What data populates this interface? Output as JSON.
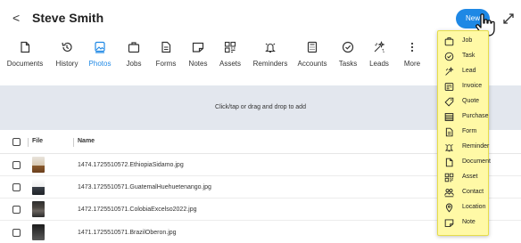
{
  "header": {
    "back_glyph": "<",
    "title": "Steve Smith",
    "new_label": "New"
  },
  "tabs": [
    {
      "label": "Documents",
      "icon": "document-icon"
    },
    {
      "label": "History",
      "icon": "history-icon"
    },
    {
      "label": "Photos",
      "icon": "photo-icon",
      "active": true
    },
    {
      "label": "Jobs",
      "icon": "briefcase-icon"
    },
    {
      "label": "Forms",
      "icon": "form-icon"
    },
    {
      "label": "Notes",
      "icon": "note-icon"
    },
    {
      "label": "Assets",
      "icon": "asset-icon"
    },
    {
      "label": "Reminders",
      "icon": "bell-icon"
    },
    {
      "label": "Accounts",
      "icon": "calculator-icon"
    },
    {
      "label": "Tasks",
      "icon": "check-circle-icon"
    },
    {
      "label": "Leads",
      "icon": "sparkle-icon"
    },
    {
      "label": "More",
      "icon": "more-vertical-icon"
    }
  ],
  "dropzone": {
    "text": "Click/tap or drag and drop to add"
  },
  "table": {
    "headers": {
      "file": "File",
      "name": "Name"
    },
    "rows": [
      {
        "name": "1474.1725510572.EthiopiaSidamo.jpg"
      },
      {
        "name": "1473.1725510571.GuatemalHuehuetenango.jpg"
      },
      {
        "name": "1472.1725510571.ColobiaExcelso2022.jpg"
      },
      {
        "name": "1471.1725510571.BrazilOberon.jpg"
      }
    ]
  },
  "new_menu": {
    "items": [
      {
        "label": "Job",
        "icon": "briefcase-icon"
      },
      {
        "label": "Task",
        "icon": "check-circle-icon"
      },
      {
        "label": "Lead",
        "icon": "sparkle-icon"
      },
      {
        "label": "Invoice",
        "icon": "invoice-icon"
      },
      {
        "label": "Quote",
        "icon": "tag-icon"
      },
      {
        "label": "Purchase",
        "icon": "purchase-icon"
      },
      {
        "label": "Form",
        "icon": "form-icon"
      },
      {
        "label": "Reminder",
        "icon": "bell-icon"
      },
      {
        "label": "Document",
        "icon": "document-icon"
      },
      {
        "label": "Asset",
        "icon": "asset-icon"
      },
      {
        "label": "Contact",
        "icon": "contact-icon"
      },
      {
        "label": "Location",
        "icon": "location-pin-icon"
      },
      {
        "label": "Note",
        "icon": "note-icon"
      }
    ]
  },
  "colors": {
    "accent": "#1e88e5",
    "menu_bg": "#fff9a6",
    "dropzone_bg": "#e3e7ee"
  }
}
